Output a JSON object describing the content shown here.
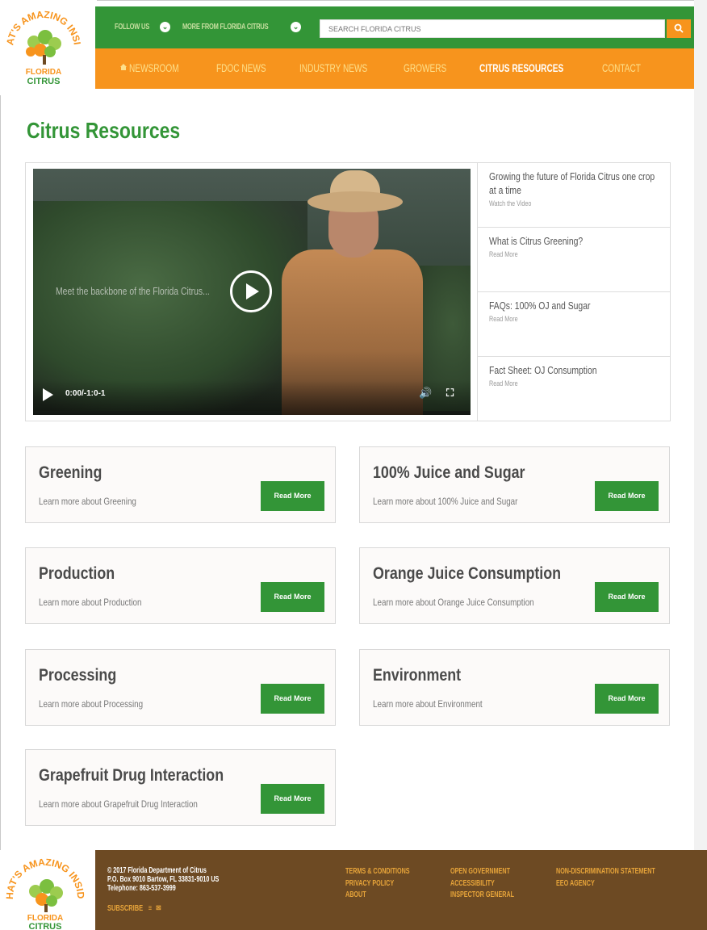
{
  "header": {
    "logo_text_top": "THAT'S AMAZING INSIDE",
    "logo_text_bottom": "FLORIDA CITRUS",
    "follow_label": "FOLLOW US",
    "more_label": "MORE FROM FLORIDA CITRUS",
    "search_placeholder": "SEARCH FLORIDA CITRUS",
    "nav": [
      {
        "label": "NEWSROOM"
      },
      {
        "label": "FDOC NEWS"
      },
      {
        "label": "INDUSTRY NEWS"
      },
      {
        "label": "GROWERS"
      },
      {
        "label": "CITRUS RESOURCES"
      },
      {
        "label": "CONTACT"
      }
    ]
  },
  "page": {
    "title": "Citrus Resources"
  },
  "video": {
    "overlay_text": "Meet the backbone of the Florida Citrus...",
    "time": "0:00/-1:0-1"
  },
  "side_list": [
    {
      "title": "Growing the future of Florida Citrus one crop at a time",
      "link": "Watch the Video"
    },
    {
      "title": "What is Citrus Greening?",
      "link": "Read More"
    },
    {
      "title": "FAQs: 100% OJ and Sugar",
      "link": "Read More"
    },
    {
      "title": "Fact Sheet: OJ Consumption",
      "link": "Read More"
    }
  ],
  "cards": [
    {
      "title": "Greening",
      "desc": "Learn more about Greening",
      "button": "Read More"
    },
    {
      "title": "100% Juice and Sugar",
      "desc": "Learn more about 100% Juice and Sugar",
      "button": "Read More"
    },
    {
      "title": "Production",
      "desc": "Learn more about Production",
      "button": "Read More"
    },
    {
      "title": "Orange Juice Consumption",
      "desc": "Learn more about Orange Juice Consumption",
      "button": "Read More"
    },
    {
      "title": "Processing",
      "desc": "Learn more about Processing",
      "button": "Read More"
    },
    {
      "title": "Environment",
      "desc": "Learn more about Environment",
      "button": "Read More"
    },
    {
      "title": "Grapefruit Drug Interaction",
      "desc": "Learn more about Grapefruit Drug Interaction",
      "button": "Read More"
    }
  ],
  "footer": {
    "copyright": "© 2017 Florida Department of Citrus",
    "address": "P.O. Box 9010 Bartow, FL 33831-9010 US",
    "phone": "Telephone: 863-537-3999",
    "subscribe": "SUBSCRIBE",
    "col1": [
      "TERMS & CONDITIONS",
      "PRIVACY POLICY",
      "ABOUT"
    ],
    "col2": [
      "OPEN GOVERNMENT",
      "ACCESSIBILITY",
      "INSPECTOR GENERAL"
    ],
    "col3": [
      "NON-DISCRIMINATION STATEMENT",
      "EEO AGENCY"
    ]
  },
  "colors": {
    "green": "#339537",
    "orange": "#f7941d",
    "brown": "#6d4a23",
    "footer_link": "#e8a53a"
  },
  "icons": {
    "search": "search-icon",
    "home": "home-icon",
    "chevron": "chevron-down-icon",
    "play": "play-icon",
    "volume": "volume-icon",
    "fullscreen": "fullscreen-icon",
    "rss": "rss-icon",
    "mail": "mail-icon"
  }
}
